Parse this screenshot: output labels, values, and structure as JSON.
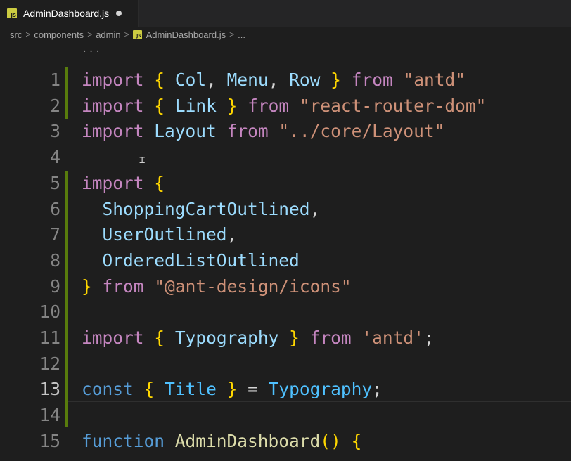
{
  "tab": {
    "file_badge": "JS",
    "label": "AdminDashboard.js"
  },
  "breadcrumb": {
    "items": [
      "src",
      "components",
      "admin",
      "AdminDashboard.js",
      "..."
    ],
    "separator": ">"
  },
  "editor": {
    "top_ellipsis": "...",
    "lines": [
      {
        "number": "1",
        "tokens": [
          [
            "k",
            "import"
          ],
          [
            "p",
            " "
          ],
          [
            "b",
            "{"
          ],
          [
            "p",
            " "
          ],
          [
            "v",
            "Col"
          ],
          [
            "p",
            ", "
          ],
          [
            "v",
            "Menu"
          ],
          [
            "p",
            ", "
          ],
          [
            "v",
            "Row"
          ],
          [
            "p",
            " "
          ],
          [
            "b",
            "}"
          ],
          [
            "p",
            " "
          ],
          [
            "k",
            "from"
          ],
          [
            "p",
            " "
          ],
          [
            "s",
            "\"antd\""
          ]
        ]
      },
      {
        "number": "2",
        "tokens": [
          [
            "k",
            "import"
          ],
          [
            "p",
            " "
          ],
          [
            "b",
            "{"
          ],
          [
            "p",
            " "
          ],
          [
            "v",
            "Link"
          ],
          [
            "p",
            " "
          ],
          [
            "b",
            "}"
          ],
          [
            "p",
            " "
          ],
          [
            "k",
            "from"
          ],
          [
            "p",
            " "
          ],
          [
            "s",
            "\"react-router-dom\""
          ]
        ]
      },
      {
        "number": "3",
        "tokens": [
          [
            "k",
            "import"
          ],
          [
            "p",
            " "
          ],
          [
            "v",
            "Layout"
          ],
          [
            "p",
            " "
          ],
          [
            "k",
            "from"
          ],
          [
            "p",
            " "
          ],
          [
            "s",
            "\"../core/Layout\""
          ]
        ]
      },
      {
        "number": "4",
        "tokens": []
      },
      {
        "number": "5",
        "tokens": [
          [
            "k",
            "import"
          ],
          [
            "p",
            " "
          ],
          [
            "b",
            "{"
          ]
        ]
      },
      {
        "number": "6",
        "tokens": [
          [
            "p",
            "  "
          ],
          [
            "v",
            "ShoppingCartOutlined"
          ],
          [
            "p",
            ","
          ]
        ]
      },
      {
        "number": "7",
        "tokens": [
          [
            "p",
            "  "
          ],
          [
            "v",
            "UserOutlined"
          ],
          [
            "p",
            ","
          ]
        ]
      },
      {
        "number": "8",
        "tokens": [
          [
            "p",
            "  "
          ],
          [
            "v",
            "OrderedListOutlined"
          ]
        ]
      },
      {
        "number": "9",
        "tokens": [
          [
            "b",
            "}"
          ],
          [
            "p",
            " "
          ],
          [
            "k",
            "from"
          ],
          [
            "p",
            " "
          ],
          [
            "s",
            "\"@ant-design/icons\""
          ]
        ]
      },
      {
        "number": "10",
        "tokens": []
      },
      {
        "number": "11",
        "tokens": [
          [
            "k",
            "import"
          ],
          [
            "p",
            " "
          ],
          [
            "b",
            "{"
          ],
          [
            "p",
            " "
          ],
          [
            "v",
            "Typography"
          ],
          [
            "p",
            " "
          ],
          [
            "b",
            "}"
          ],
          [
            "p",
            " "
          ],
          [
            "k",
            "from"
          ],
          [
            "p",
            " "
          ],
          [
            "s",
            "'antd'"
          ],
          [
            "p",
            ";"
          ]
        ]
      },
      {
        "number": "12",
        "tokens": []
      },
      {
        "number": "13",
        "tokens": [
          [
            "c",
            "const"
          ],
          [
            "p",
            " "
          ],
          [
            "b",
            "{"
          ],
          [
            "p",
            " "
          ],
          [
            "t",
            "Title"
          ],
          [
            "p",
            " "
          ],
          [
            "b",
            "}"
          ],
          [
            "p",
            " = "
          ],
          [
            "t",
            "Typography"
          ],
          [
            "p",
            ";"
          ]
        ]
      },
      {
        "number": "14",
        "tokens": []
      },
      {
        "number": "15",
        "tokens": [
          [
            "c",
            "function"
          ],
          [
            "p",
            " "
          ],
          [
            "f",
            "AdminDashboard"
          ],
          [
            "b",
            "()"
          ],
          [
            "p",
            " "
          ],
          [
            "b",
            "{"
          ]
        ]
      }
    ],
    "active_line": "13"
  },
  "colors": {
    "background": "#1e1e1e",
    "keyword_import": "#c586c0",
    "string": "#ce9178",
    "variable": "#9cdcfe",
    "bracket": "#ffd700",
    "constant": "#4fc1ff",
    "storage": "#569cd6",
    "function": "#dcdcaa",
    "git_added": "#587c0c"
  }
}
